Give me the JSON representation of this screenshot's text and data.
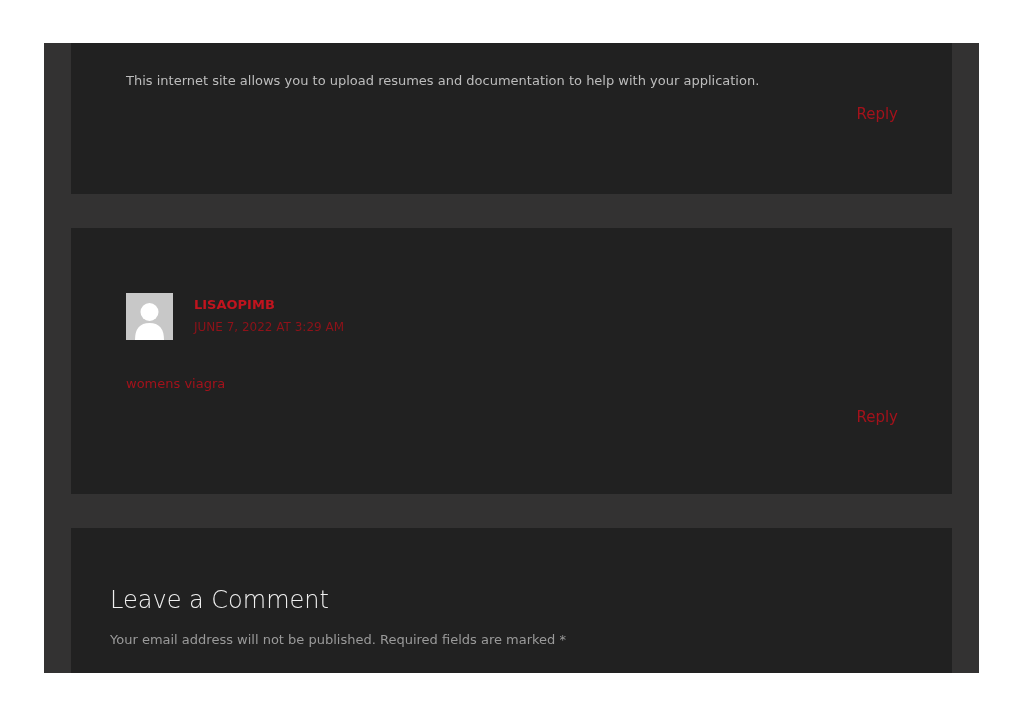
{
  "comments": [
    {
      "text": "This internet site allows you to upload resumes and documentation to help with your application.",
      "kind": "plain",
      "reply": "Reply"
    },
    {
      "author": "LISAOPIMB",
      "date": "JUNE 7, 2022 AT 3:29 AM",
      "text": "womens viagra",
      "kind": "link",
      "reply": "Reply"
    }
  ],
  "comment_form": {
    "title": "Leave a Comment",
    "notes": "Your email address will not be published. Required fields are marked *"
  }
}
